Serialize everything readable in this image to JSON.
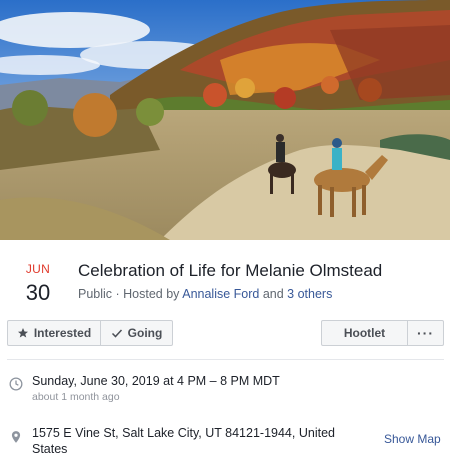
{
  "event": {
    "month": "JUN",
    "day": "30",
    "title": "Celebration of Life for Melanie Olmstead",
    "visibility": "Public",
    "hosted_by_prefix": " · Hosted by ",
    "host": "Annalise Ford",
    "and": " and ",
    "others": "3 others"
  },
  "actions": {
    "interested": "Interested",
    "going": "Going",
    "hootlet": "Hootlet",
    "more": "···"
  },
  "details": {
    "datetime": "Sunday, June 30, 2019 at 4 PM – 8 PM MDT",
    "relative": "about 1 month ago",
    "address": "1575 E Vine St, Salt Lake City, UT 84121-1944, United States",
    "show_map": "Show Map"
  },
  "colors": {
    "month": "#e0392b",
    "link": "#385898",
    "button_bg": "#f5f6f7"
  },
  "icons": {
    "interested": "star-icon",
    "going": "checkmark-icon",
    "time": "clock-icon",
    "location": "location-pin-icon"
  }
}
